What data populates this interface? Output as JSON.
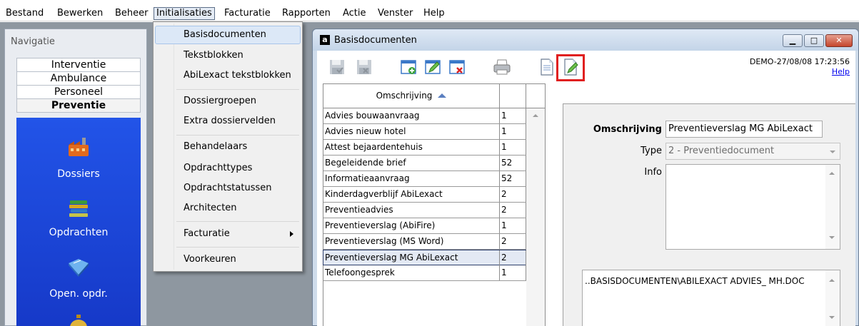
{
  "menubar": {
    "items": [
      "Bestand",
      "Bewerken",
      "Beheer",
      "Initialisaties",
      "Facturatie",
      "Rapporten",
      "Actie",
      "Venster",
      "Help"
    ]
  },
  "nav": {
    "title": "Navigatie",
    "categories": [
      "Interventie",
      "Ambulance",
      "Personeel",
      "Preventie"
    ],
    "active_category": "Preventie",
    "modules": [
      {
        "label": "Dossiers",
        "icon": "factory-icon"
      },
      {
        "label": "Opdrachten",
        "icon": "stacked-books-icon"
      },
      {
        "label": "Open. opdr.",
        "icon": "open-book-icon"
      },
      {
        "label": "",
        "icon": "money-bag-icon"
      }
    ]
  },
  "dropdown": {
    "items": [
      "Basisdocumenten",
      "Tekstblokken",
      "AbiLexact tekstblokken",
      "Dossiergroepen",
      "Extra dossiervelden",
      "Behandelaars",
      "Opdrachttypes",
      "Opdrachtstatussen",
      "Architecten",
      "Facturatie",
      "Voorkeuren"
    ],
    "highlighted": "Basisdocumenten",
    "submenu_item": "Facturatie"
  },
  "window": {
    "title": "Basisdocumenten",
    "icon_letter": "a",
    "status_line": "DEMO-27/08/08 17:23:56",
    "help_link": "Help",
    "toolbar": [
      "save-icon",
      "save-close-icon",
      "new-record-icon",
      "edit-record-icon",
      "delete-record-icon",
      "print-icon",
      "document-icon",
      "edit-document-icon"
    ],
    "highlight_color": "#e02020"
  },
  "list": {
    "column_header": "Omschrijving",
    "rows": [
      {
        "name": "Advies bouwaanvraag",
        "value": "1"
      },
      {
        "name": "Advies nieuw hotel",
        "value": "1"
      },
      {
        "name": "Attest bejaardentehuis",
        "value": "1"
      },
      {
        "name": "Begeleidende brief",
        "value": "52"
      },
      {
        "name": "Informatieaanvraag",
        "value": "52"
      },
      {
        "name": "Kinderdagverblijf AbiLexact",
        "value": "2"
      },
      {
        "name": "Preventieadvies",
        "value": "2"
      },
      {
        "name": "Preventieverslag (AbiFire)",
        "value": "1"
      },
      {
        "name": "Preventieverslag (MS Word)",
        "value": "2"
      },
      {
        "name": "Preventieverslag MG AbiLexact",
        "value": "2"
      },
      {
        "name": "Telefoongesprek",
        "value": "1"
      }
    ],
    "selected_index": 9
  },
  "form": {
    "omschrijving_label": "Omschrijving",
    "omschrijving_value": "Preventieverslag MG AbiLexact",
    "type_label": "Type",
    "type_value": "2 - Preventiedocument",
    "info_label": "Info",
    "info_value": "",
    "path_value": "..BASISDOCUMENTEN\\ABILEXACT ADVIES_ MH.DOC"
  }
}
